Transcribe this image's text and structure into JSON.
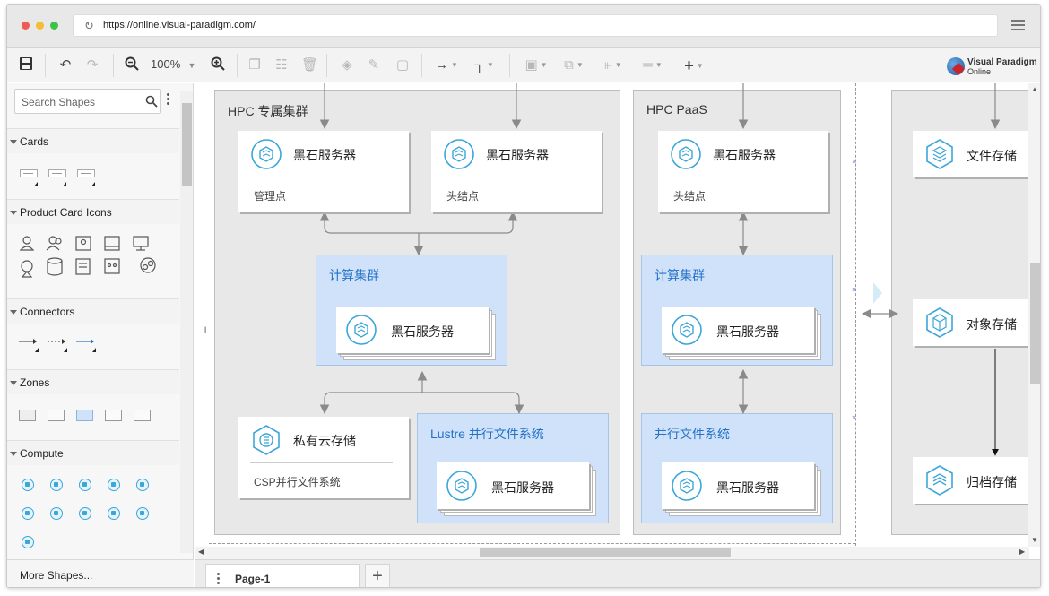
{
  "browser": {
    "url": "https://online.visual-paradigm.com/"
  },
  "toolbar": {
    "zoom": "100%",
    "logo_line1": "Visual Paradigm",
    "logo_line2": "Online"
  },
  "left_panel": {
    "search_placeholder": "Search Shapes",
    "categories": [
      "Cards",
      "Product Card Icons",
      "Connectors",
      "Zones",
      "Compute"
    ],
    "more_shapes": "More Shapes..."
  },
  "pages": {
    "tabs": [
      "Page-1"
    ]
  },
  "diagram": {
    "zones": {
      "hpc_dedicated": "HPC 专属集群",
      "hpc_paas": "HPC PaaS"
    },
    "blue_zones": {
      "compute_cluster_1": "计算集群",
      "lustre": "Lustre 并行文件系统",
      "compute_cluster_2": "计算集群",
      "parallel_fs": "并行文件系统"
    },
    "cards": {
      "mgmt_title": "黑石服务器",
      "mgmt_sub": "管理点",
      "head1_title": "黑石服务器",
      "head1_sub": "头结点",
      "compute1_title": "黑石服务器",
      "private_storage_title": "私有云存储",
      "private_storage_sub": "CSP并行文件系统",
      "lustre_server_title": "黑石服务器",
      "head2_title": "黑石服务器",
      "head2_sub": "头结点",
      "compute2_title": "黑石服务器",
      "pfs_server_title": "黑石服务器",
      "file_storage_title": "文件存储",
      "object_storage_title": "对象存储",
      "archive_storage_title": "归档存储"
    }
  },
  "colors": {
    "accent_blue": "#2472c8",
    "icon_cyan": "#3aa6d9",
    "zone_gray": "#e8e8e8",
    "zone_blue": "#cfe2fa"
  }
}
